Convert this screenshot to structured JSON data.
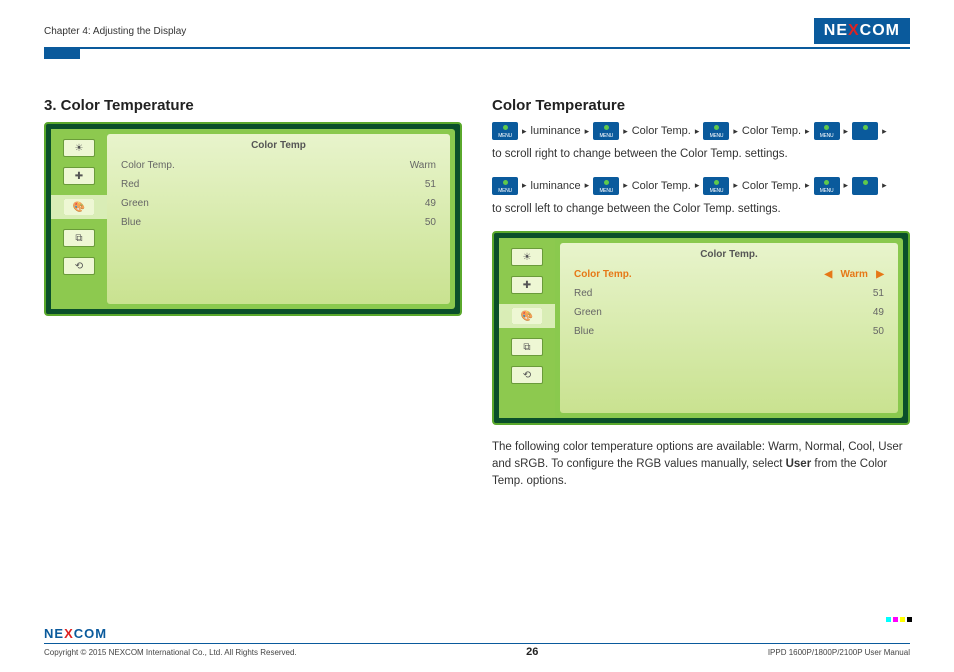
{
  "header": {
    "chapter": "Chapter 4: Adjusting the Display",
    "brand_pre": "NE",
    "brand_x": "X",
    "brand_post": "COM"
  },
  "left": {
    "heading": "3. Color Temperature",
    "osd": {
      "title": "Color Temp",
      "rows": [
        {
          "label": "Color Temp.",
          "value": "Warm"
        },
        {
          "label": "Red",
          "value": "51"
        },
        {
          "label": "Green",
          "value": "49"
        },
        {
          "label": "Blue",
          "value": "50"
        }
      ]
    }
  },
  "right": {
    "heading": "Color Temperature",
    "nav1": {
      "btn1": "MENU",
      "t1": "luminance",
      "btn2": "MENU",
      "t2": "Color Temp.",
      "btn3": "MENU",
      "t3": "Color Temp.",
      "btn4": "MENU",
      "btn5": "▶"
    },
    "text1": "to scroll right to change between the Color Temp. settings.",
    "nav2": {
      "btn1": "MENU",
      "t1": "luminance",
      "btn2": "MENU",
      "t2": "Color Temp.",
      "btn3": "MENU",
      "t3": "Color Temp.",
      "btn4": "MENU",
      "btn5": "◀"
    },
    "text2": "to scroll left to change between the Color Temp. settings.",
    "osd": {
      "title": "Color Temp.",
      "active": {
        "label": "Color Temp.",
        "left": "◀",
        "value": "Warm",
        "right": "▶"
      },
      "rows": [
        {
          "label": "Red",
          "value": "51"
        },
        {
          "label": "Green",
          "value": "49"
        },
        {
          "label": "Blue",
          "value": "50"
        }
      ]
    },
    "text3a": "The following color temperature options are available: Warm, Normal, Cool, User and sRGB. To configure the RGB values manually, select ",
    "text3b": "User",
    "text3c": " from the Color Temp. options."
  },
  "footer": {
    "brand_pre": "NE",
    "brand_x": "X",
    "brand_post": "COM",
    "copyright": "Copyright © 2015 NEXCOM International Co., Ltd. All Rights Reserved.",
    "page": "26",
    "manual": "IPPD 1600P/1800P/2100P User Manual"
  }
}
